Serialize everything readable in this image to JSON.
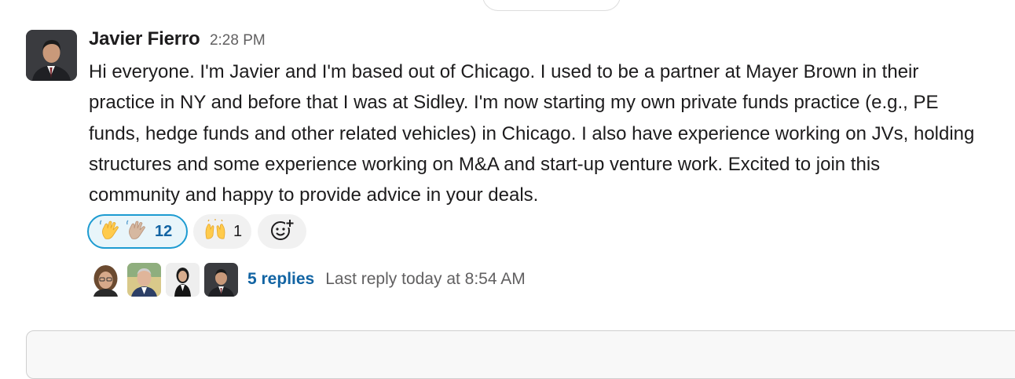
{
  "message": {
    "author": "Javier Fierro",
    "timestamp": "2:28 PM",
    "lines": [
      "Hi everyone.  I'm Javier and I'm based out of Chicago.  I used to be a partner at Mayer Brown in their",
      "practice in NY and before that I was at Sidley. I'm now starting my own private funds practice (e.g., PE",
      "funds, hedge funds and other related vehicles) in Chicago.  I also have experience working on JVs, holding",
      "structures and some experience working on M&A and start-up venture work.  Excited to join this",
      "community and happy to provide advice in your deals."
    ]
  },
  "reactions": [
    {
      "emoji": [
        "waving-hand",
        "waving-hand-light-skin"
      ],
      "count": "12",
      "active": true
    },
    {
      "emoji": [
        "raising-hands"
      ],
      "count": "1",
      "active": false
    }
  ],
  "thread": {
    "participant_avatars": [
      "person-curly-hair",
      "person-gray-hair",
      "person-woman",
      "person-javier"
    ],
    "replies_label": "5 replies",
    "last_reply": "Last reply today at 8:54 AM"
  },
  "colors": {
    "link": "#1264a3",
    "active_reaction_border": "#1d9bd1",
    "active_reaction_bg": "#e8f5fa",
    "muted_text": "#616061"
  }
}
